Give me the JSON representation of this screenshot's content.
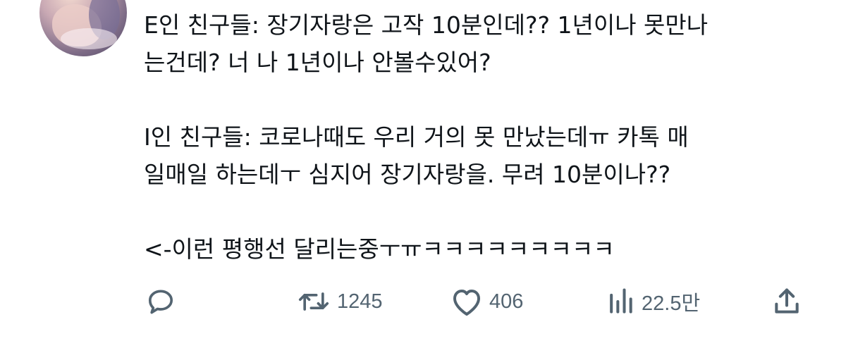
{
  "tweet": {
    "paragraphs": [
      [
        "E인 친구들: 장기자랑은 고작 10분인데?? 1년이나 못만나",
        "는건데? 너 나 1년이나 안볼수있어?"
      ],
      [
        "I인 친구들: 코로나때도 우리 거의 못 만났는데ㅠ 카톡 매",
        "일매일 하는데ㅜ 심지어 장기자랑을. 무려 10분이나??"
      ],
      [
        "<-이런 평행선 달리는중ㅜㅠㅋㅋㅋㅋㅋㅋㅋㅋㅋ"
      ]
    ]
  },
  "actions": {
    "reply": {
      "icon": "reply-icon",
      "count": ""
    },
    "retweet": {
      "icon": "retweet-icon",
      "count": "1245"
    },
    "like": {
      "icon": "heart-icon",
      "count": "406"
    },
    "views": {
      "icon": "views-icon",
      "count": "22.5만"
    },
    "share": {
      "icon": "share-icon",
      "count": ""
    }
  },
  "colors": {
    "text": "#0f1419",
    "muted": "#536471",
    "background": "#ffffff"
  }
}
